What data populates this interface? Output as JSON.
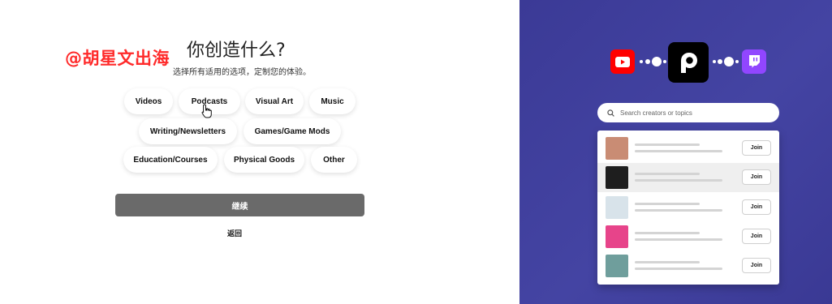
{
  "watermark": "@胡星文出海",
  "heading": {
    "title": "你创造什么?",
    "subtitle": "选择所有适用的选项，定制您的体验。"
  },
  "categories": [
    "Videos",
    "Podcasts",
    "Visual Art",
    "Music",
    "Writing/Newsletters",
    "Games/Game Mods",
    "Education/Courses",
    "Physical Goods",
    "Other"
  ],
  "actions": {
    "continue_label": "继续",
    "back_label": "返回"
  },
  "illustration": {
    "search_placeholder": "Search creators or topics",
    "join_label": "Join",
    "creator_rows": [
      {
        "thumb_color": "#c98c74",
        "highlighted": false
      },
      {
        "thumb_color": "#1e1e1e",
        "highlighted": true
      },
      {
        "thumb_color": "#d8e3ea",
        "highlighted": false
      },
      {
        "thumb_color": "#e7448a",
        "highlighted": false
      },
      {
        "thumb_color": "#6f9e9c",
        "highlighted": false
      }
    ],
    "icons": [
      "youtube-icon",
      "patreon-icon",
      "twitch-icon"
    ],
    "colors": {
      "youtube": "#ff0000",
      "patreon": "#000000",
      "twitch": "#9146ff",
      "background": "#4141a0",
      "continue_button": "#6a6a6a"
    }
  }
}
